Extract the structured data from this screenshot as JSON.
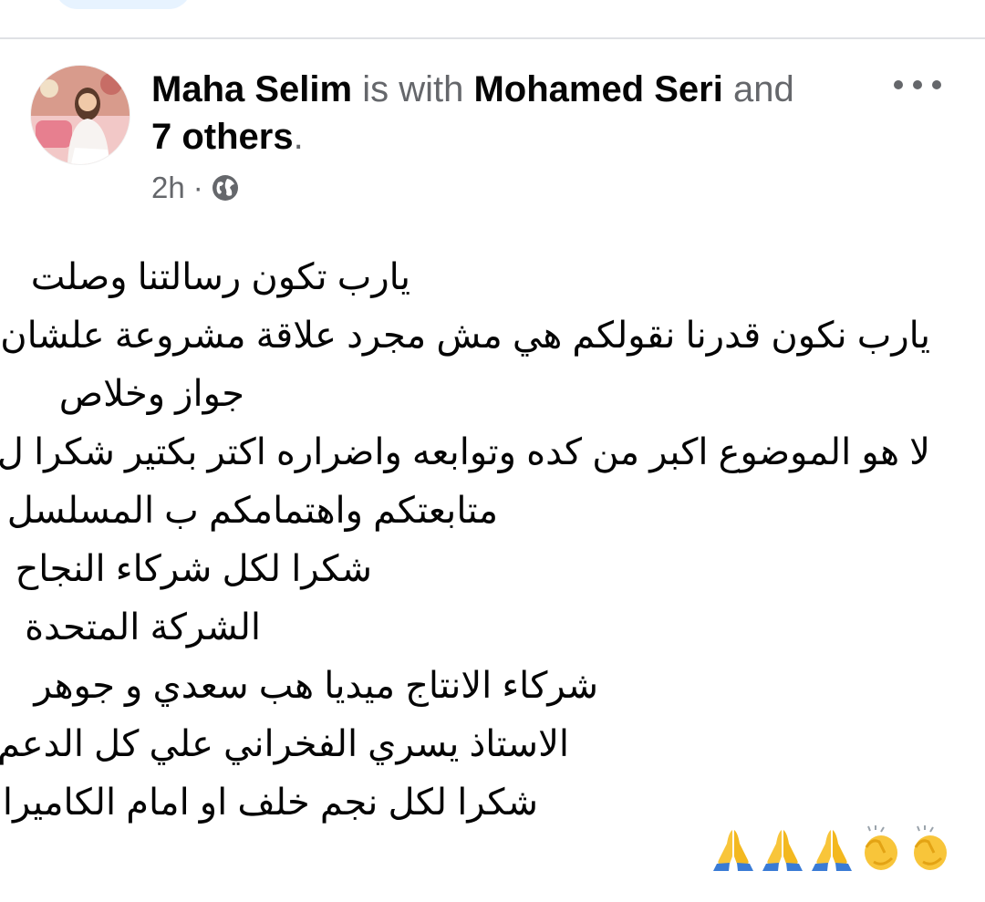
{
  "post": {
    "author": "Maha Selim",
    "with_text": " is with ",
    "tagged": "Mohamed Seri",
    "and_text": " and",
    "others": "7 others",
    "period": ".",
    "time": "2h",
    "separator": "·",
    "privacy_icon": "globe-icon",
    "lines": [
      "يارب تكون رسالتنا وصلت",
      "يارب نكون قدرنا نقولكم هي مش مجرد علاقة مشروعة علشان",
      "جواز  وخلاص",
      "لا هو الموضوع اكبر من كده وتوابعه واضراره اكتر بكتير شكرا ل",
      "متابعتكم واهتمامكم ب المسلسل",
      "شكرا لكل شركاء النجاح",
      "الشركة المتحدة",
      "شركاء الانتاج ميديا هب سعدي و جوهر",
      "الاستاذ يسري الفخراني علي كل الدعم",
      "شكرا لكل نجم خلف او امام الكاميرا"
    ],
    "emojis": [
      "folded-hands",
      "folded-hands",
      "folded-hands",
      "clapping-hands",
      "clapping-hands"
    ]
  },
  "colors": {
    "primary_text": "#050505",
    "secondary_text": "#65676b",
    "divider": "#dfe1e5"
  }
}
